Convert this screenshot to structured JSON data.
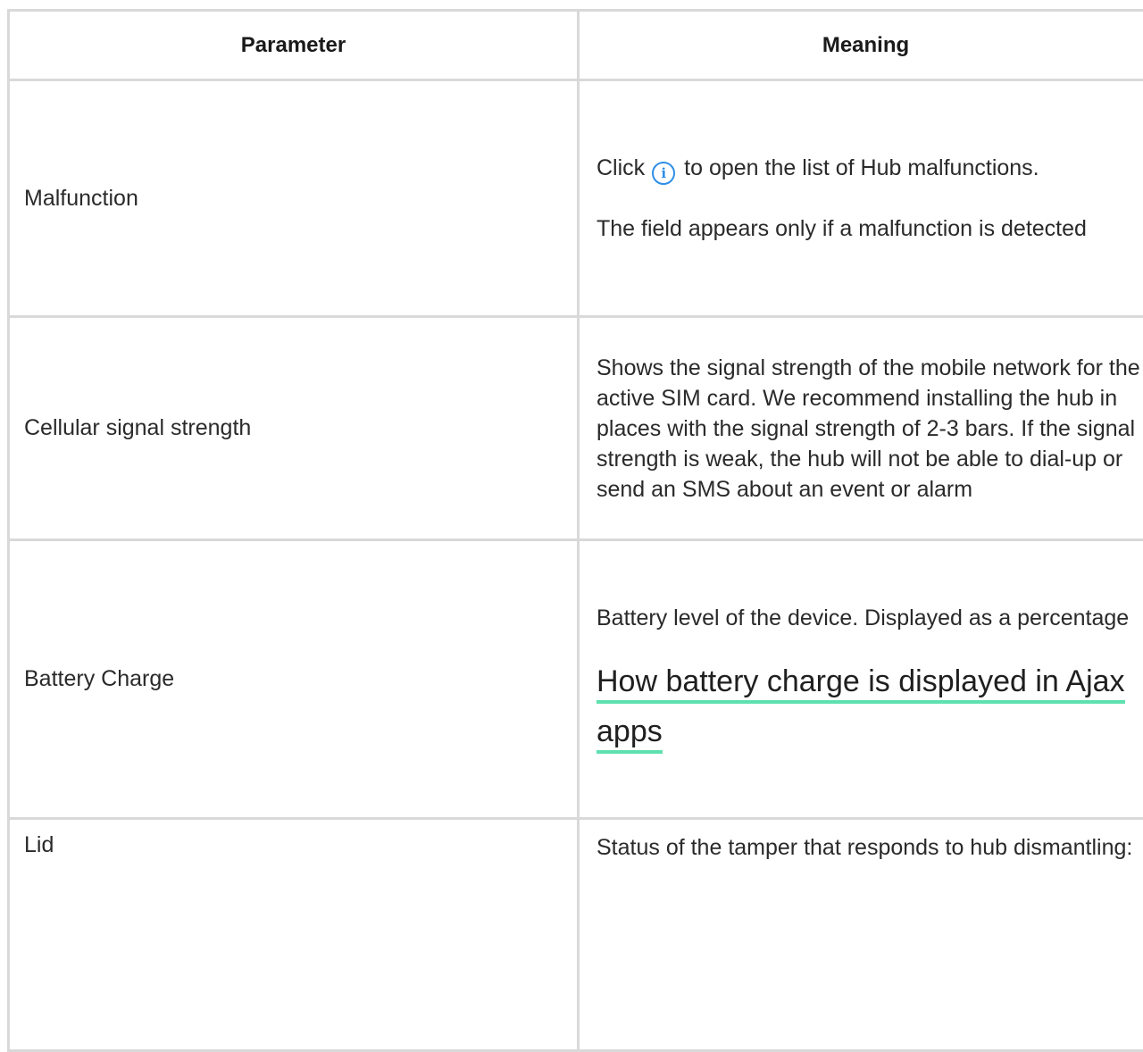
{
  "table": {
    "headers": {
      "parameter": "Parameter",
      "meaning": "Meaning"
    },
    "rows": [
      {
        "parameter": "Malfunction",
        "meaning_before_icon": "Click",
        "meaning_after_icon": "to open the list of Hub malfunctions.",
        "meaning_note": "The field appears only if a malfunction is detected",
        "icon": "info-icon"
      },
      {
        "parameter": "Cellular signal strength",
        "meaning": "Shows the signal strength of the mobile network for the active SIM card. We recommend installing the hub in places with the signal strength of 2-3 bars. If the signal strength is weak, the hub will not be able to dial-up or send an SMS about an event or alarm"
      },
      {
        "parameter": "Battery Charge",
        "meaning": "Battery level of the device. Displayed as a percentage",
        "link_text": "How battery charge is displayed in Ajax apps"
      },
      {
        "parameter": "Lid",
        "meaning": "Status of the tamper that responds to hub dismantling:"
      }
    ]
  },
  "colors": {
    "border": "#d9d9d9",
    "info_icon": "#2f8fe8",
    "link_underline": "#5fe0b0"
  }
}
